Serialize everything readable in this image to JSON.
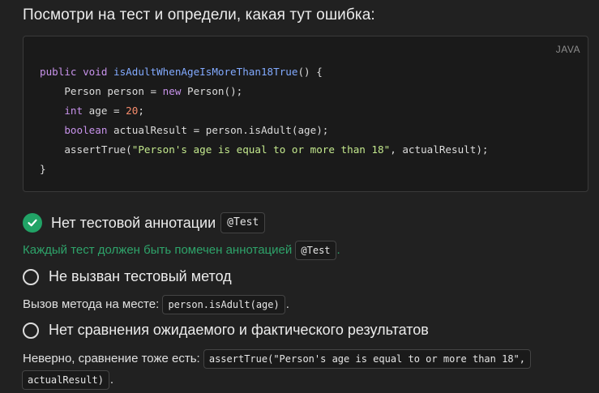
{
  "question": "Посмотри на тест и определи, какая тут ошибка:",
  "code": {
    "language": "JAVA",
    "lines": [
      [
        {
          "t": "kw",
          "v": "public void "
        },
        {
          "t": "fn",
          "v": "isAdultWhenAgeIsMoreThan18True"
        },
        {
          "t": "plain",
          "v": "() {"
        }
      ],
      [
        {
          "t": "plain",
          "v": "    Person person = "
        },
        {
          "t": "kw",
          "v": "new"
        },
        {
          "t": "plain",
          "v": " Person();"
        }
      ],
      [
        {
          "t": "plain",
          "v": "    "
        },
        {
          "t": "kw",
          "v": "int"
        },
        {
          "t": "plain",
          "v": " age = "
        },
        {
          "t": "num",
          "v": "20"
        },
        {
          "t": "plain",
          "v": ";"
        }
      ],
      [
        {
          "t": "plain",
          "v": "    "
        },
        {
          "t": "kw",
          "v": "boolean"
        },
        {
          "t": "plain",
          "v": " actualResult = person.isAdult(age);"
        }
      ],
      [
        {
          "t": "plain",
          "v": "    assertTrue("
        },
        {
          "t": "str",
          "v": "\"Person's age is equal to or more than 18\""
        },
        {
          "t": "plain",
          "v": ", actualResult);"
        }
      ],
      [
        {
          "t": "plain",
          "v": "}"
        }
      ]
    ]
  },
  "options": [
    {
      "label": "Нет тестовой аннотации",
      "code": "@Test",
      "selected": true,
      "feedback_text": "Каждый тест должен быть помечен аннотацией",
      "feedback_code": "@Test",
      "feedback_end": "."
    },
    {
      "label": "Не вызван тестовый метод",
      "selected": false,
      "feedback_text": "Вызов метода на месте:",
      "feedback_code": "person.isAdult(age)",
      "feedback_end": "."
    },
    {
      "label": "Нет сравнения ожидаемого и фактического результатов",
      "selected": false,
      "feedback_text": "Неверно, сравнение тоже есть:",
      "feedback_code_1": "assertTrue(\"Person's age is equal to or more than 18\",",
      "feedback_code_2": "actualResult)",
      "feedback_end": "."
    }
  ],
  "colors": {
    "correct": "#21a366",
    "keyword": "#c792ea",
    "function": "#82aaff",
    "number": "#f78c6c",
    "string": "#c3e88d"
  },
  "icons": {
    "selected": "check-icon"
  }
}
